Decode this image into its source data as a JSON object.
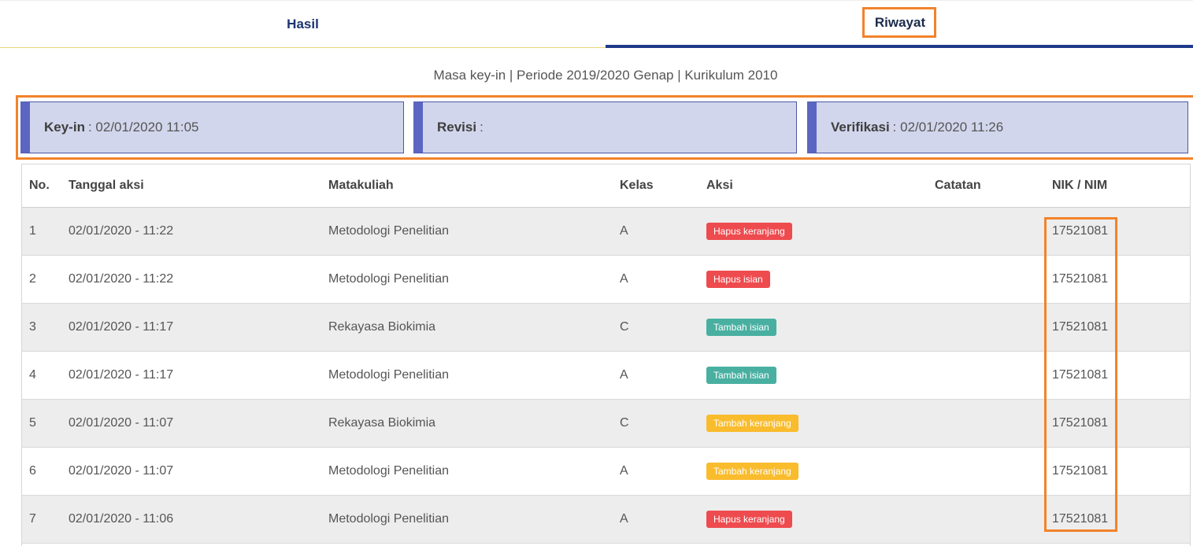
{
  "tabs": [
    {
      "label": "Hasil"
    },
    {
      "label": "Riwayat"
    }
  ],
  "subtitle": "Masa key-in | Periode 2019/2020 Genap | Kurikulum 2010",
  "info": {
    "keyin_label": "Key-in",
    "keyin_value": ": 02/01/2020 11:05",
    "revisi_label": "Revisi",
    "revisi_value": ":",
    "verifikasi_label": "Verifikasi",
    "verifikasi_value": ": 02/01/2020 11:26"
  },
  "table": {
    "headers": {
      "no": "No.",
      "tanggal": "Tanggal aksi",
      "matakuliah": "Matakuliah",
      "kelas": "Kelas",
      "aksi": "Aksi",
      "catatan": "Catatan",
      "nik": "NIK / NIM"
    },
    "rows": [
      {
        "no": "1",
        "tanggal": "02/01/2020 - 11:22",
        "matakuliah": "Metodologi Penelitian",
        "kelas": "A",
        "aksi": "Hapus keranjang",
        "aksi_color": "red",
        "catatan": "",
        "nik": "17521081"
      },
      {
        "no": "2",
        "tanggal": "02/01/2020 - 11:22",
        "matakuliah": "Metodologi Penelitian",
        "kelas": "A",
        "aksi": "Hapus isian",
        "aksi_color": "red",
        "catatan": "",
        "nik": "17521081"
      },
      {
        "no": "3",
        "tanggal": "02/01/2020 - 11:17",
        "matakuliah": "Rekayasa Biokimia",
        "kelas": "C",
        "aksi": "Tambah isian",
        "aksi_color": "teal",
        "catatan": "",
        "nik": "17521081"
      },
      {
        "no": "4",
        "tanggal": "02/01/2020 - 11:17",
        "matakuliah": "Metodologi Penelitian",
        "kelas": "A",
        "aksi": "Tambah isian",
        "aksi_color": "teal",
        "catatan": "",
        "nik": "17521081"
      },
      {
        "no": "5",
        "tanggal": "02/01/2020 - 11:07",
        "matakuliah": "Rekayasa Biokimia",
        "kelas": "C",
        "aksi": "Tambah keranjang",
        "aksi_color": "yellow",
        "catatan": "",
        "nik": "17521081"
      },
      {
        "no": "6",
        "tanggal": "02/01/2020 - 11:07",
        "matakuliah": "Metodologi Penelitian",
        "kelas": "A",
        "aksi": "Tambah keranjang",
        "aksi_color": "yellow",
        "catatan": "",
        "nik": "17521081"
      },
      {
        "no": "7",
        "tanggal": "02/01/2020 - 11:06",
        "matakuliah": "Metodologi Penelitian",
        "kelas": "A",
        "aksi": "Hapus keranjang",
        "aksi_color": "red",
        "catatan": "",
        "nik": "17521081"
      }
    ]
  },
  "colors": {
    "highlight": "#f2832b",
    "tab_active": "#1f3a8a",
    "badge_red": "#ee4b4f",
    "badge_teal": "#49b0a1",
    "badge_yellow": "#f9bc2d"
  }
}
